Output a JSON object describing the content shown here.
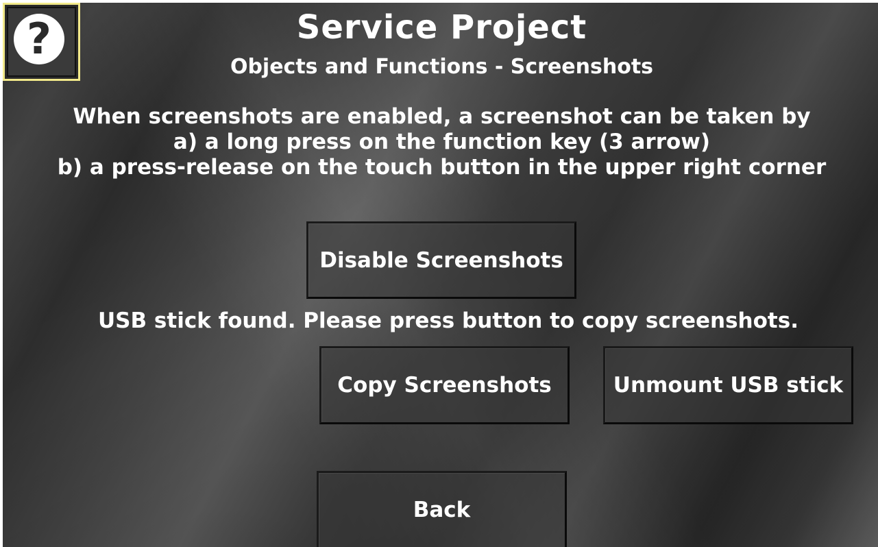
{
  "header": {
    "title": "Service Project",
    "subtitle": "Objects and Functions - Screenshots",
    "help_symbol": "?"
  },
  "description": {
    "lines": [
      "When screenshots are enabled, a screenshot can be taken by",
      "a) a long press on the function key (3 arrow)",
      "b) a press-release on the touch button in the upper right corner"
    ]
  },
  "buttons": {
    "disable_screenshots": "Disable Screenshots",
    "copy_screenshots": "Copy Screenshots",
    "unmount_usb": "Unmount USB stick",
    "back": "Back"
  },
  "status": {
    "usb_message": "USB stick found. Please press button to copy screenshots."
  },
  "icons": {
    "help": "question-mark-icon"
  },
  "colors": {
    "help_border": "#f2e98a",
    "text": "#ffffff",
    "background": "#3a3a3a"
  }
}
